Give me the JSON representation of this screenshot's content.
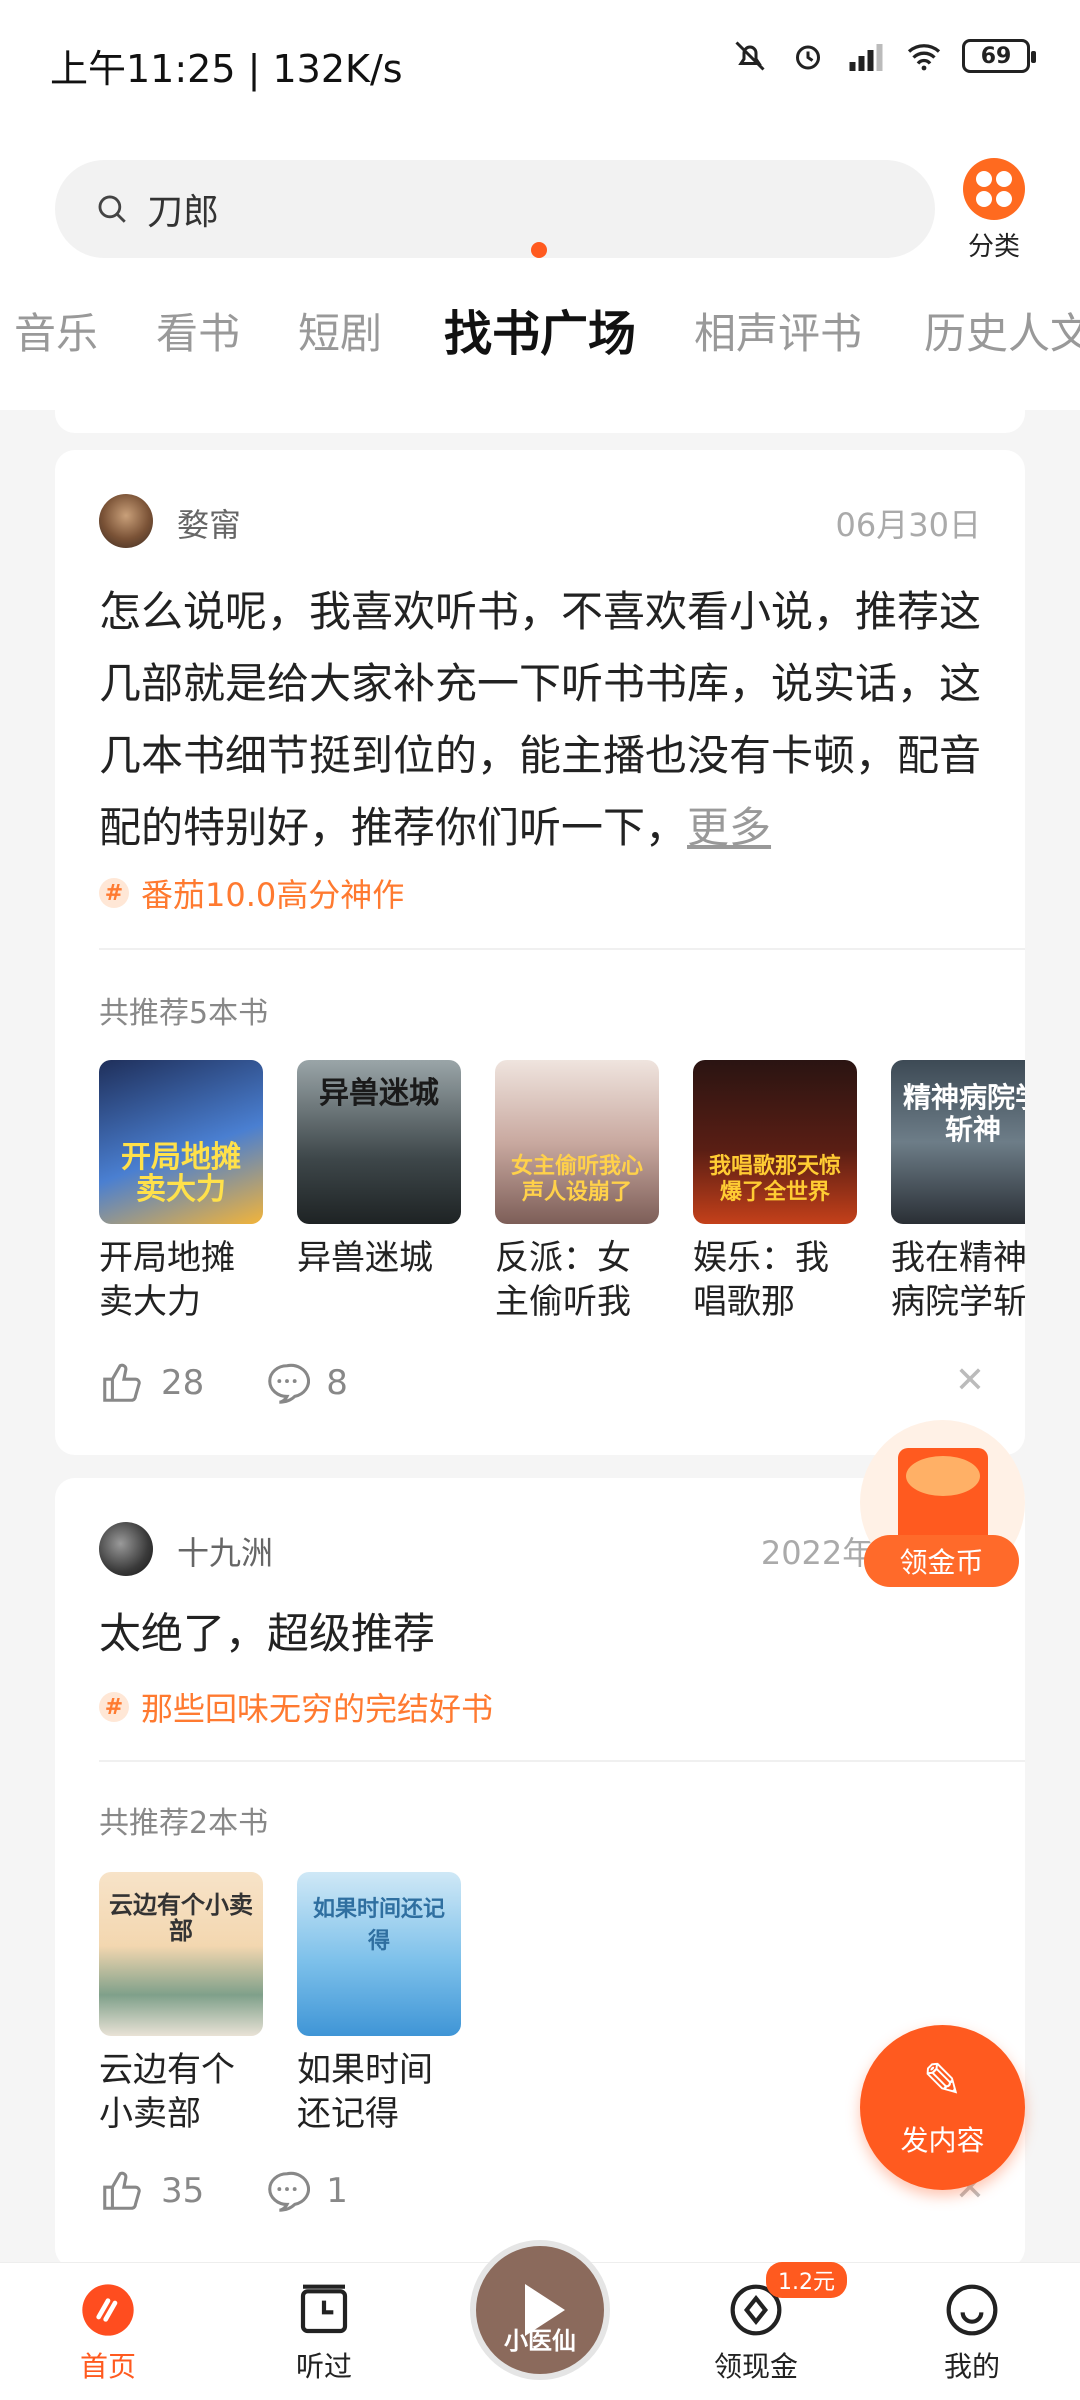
{
  "status": {
    "time": "上午11:25",
    "network": "132K/s",
    "battery": "69"
  },
  "search": {
    "query": "刀郎"
  },
  "category": {
    "label": "分类"
  },
  "tabs": [
    {
      "label": "音乐"
    },
    {
      "label": "看书"
    },
    {
      "label": "短剧"
    },
    {
      "label": "找书广场"
    },
    {
      "label": "相声评书"
    },
    {
      "label": "历史人文"
    }
  ],
  "posts": [
    {
      "username": "婺甯",
      "date": "06月30日",
      "text": "怎么说呢，我喜欢听书，不喜欢看小说，推荐这几部就是给大家补充一下听书书库，说实话，这几本书细节挺到位的，能主播也没有卡顿，配音配的特别好，推荐你们听一下，",
      "more": "更多",
      "topic": "番茄10.0高分神作",
      "rec_count": "共推荐5本书",
      "books": [
        {
          "title": "开局地摊卖大力",
          "cover_text": "开局地摊卖大力"
        },
        {
          "title": "异兽迷城",
          "cover_text": "异兽迷城"
        },
        {
          "title": "反派：女主偷听我心…",
          "cover_text": "女主偷听我心声人设崩了"
        },
        {
          "title": "娱乐：我唱歌那天，…",
          "cover_text": "我唱歌那天惊爆了全世界"
        },
        {
          "title": "我在精神病院学斩神",
          "cover_text": "精神病院学斩神"
        }
      ],
      "likes": "28",
      "comments": "8"
    },
    {
      "username": "十九洲",
      "date": "2022年07",
      "text": "太绝了，超级推荐",
      "topic": "那些回味无穷的完结好书",
      "rec_count": "共推荐2本书",
      "books": [
        {
          "title": "云边有个小卖部",
          "cover_text": "云边有个小卖部"
        },
        {
          "title": "如果时间还记得",
          "cover_text": "如果时间还记得"
        }
      ],
      "likes": "35",
      "comments": "1"
    }
  ],
  "floating": {
    "coin_label": "领金币",
    "post_label": "发内容"
  },
  "bottom_nav": [
    {
      "label": "首页"
    },
    {
      "label": "听过"
    },
    {
      "label": "领现金",
      "badge": "1.2元"
    },
    {
      "label": "我的"
    }
  ],
  "player": {
    "cover_text": "小医仙"
  },
  "colors": {
    "accent": "#ff5a1f",
    "topic": "#ff7a30"
  }
}
